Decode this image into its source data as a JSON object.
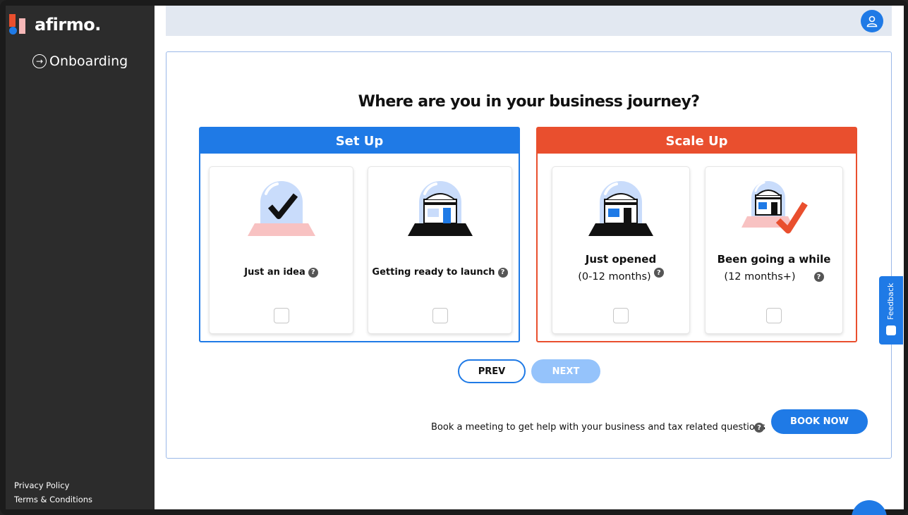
{
  "sidebar": {
    "logo_text": "afirmo.",
    "nav": [
      {
        "label": "Onboarding"
      }
    ],
    "footer": {
      "privacy": "Privacy Policy",
      "terms": "Terms & Conditions"
    }
  },
  "main": {
    "question": "Where are you in your business journey?",
    "groups": [
      {
        "title": "Set Up",
        "color": "#1f7ae6",
        "options": [
          {
            "label": "Just an idea",
            "sub": "",
            "checked": false,
            "icon": "idea-dome-check-icon"
          },
          {
            "label": "Getting ready to launch",
            "sub": "",
            "checked": false,
            "icon": "shop-dome-icon"
          }
        ]
      },
      {
        "title": "Scale Up",
        "color": "#e94f2e",
        "options": [
          {
            "label": "Just opened",
            "sub": "(0-12 months)",
            "checked": false,
            "icon": "shop-dome-icon"
          },
          {
            "label": "Been going a while",
            "sub": "(12 months+)",
            "checked": false,
            "icon": "shop-dome-check-icon"
          }
        ]
      }
    ],
    "buttons": {
      "prev": "PREV",
      "next": "NEXT"
    },
    "booking": {
      "text": "Book a meeting to get help with your business and tax related questions",
      "button": "BOOK NOW"
    }
  },
  "help_glyph": "?",
  "feedback": {
    "label": "Feedback"
  }
}
